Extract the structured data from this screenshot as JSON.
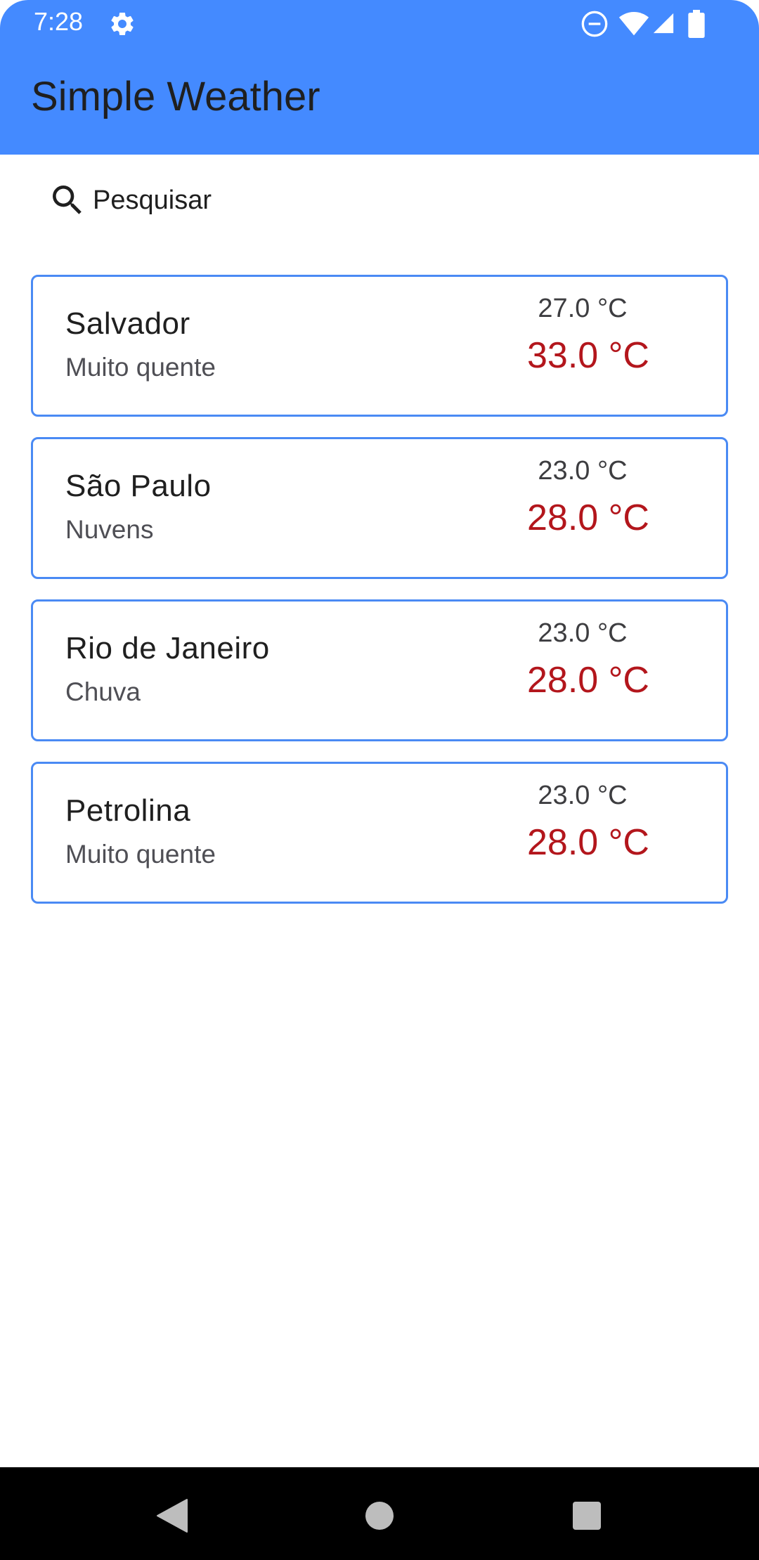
{
  "colors": {
    "app_bar": "#448aff",
    "card_border": "#4a8af4",
    "temp_max": "#b3161c"
  },
  "status_bar": {
    "time": "7:28",
    "icons": [
      "settings-icon",
      "do-not-disturb-icon",
      "wifi-icon",
      "signal-icon",
      "battery-icon"
    ]
  },
  "app_bar": {
    "title": "Simple Weather"
  },
  "search": {
    "label": "Pesquisar",
    "icon": "search-icon"
  },
  "cities": [
    {
      "name": "Salvador",
      "description": "Muito quente",
      "temp_min": "27.0 °C",
      "temp_max": "33.0 °C"
    },
    {
      "name": "São Paulo",
      "description": "Nuvens",
      "temp_min": "23.0 °C",
      "temp_max": "28.0 °C"
    },
    {
      "name": "Rio de Janeiro",
      "description": "Chuva",
      "temp_min": "23.0 °C",
      "temp_max": "28.0 °C"
    },
    {
      "name": "Petrolina",
      "description": "Muito quente",
      "temp_min": "23.0 °C",
      "temp_max": "28.0 °C"
    }
  ],
  "nav_bar": {
    "icons": [
      "back-icon",
      "home-icon",
      "recents-icon"
    ]
  }
}
